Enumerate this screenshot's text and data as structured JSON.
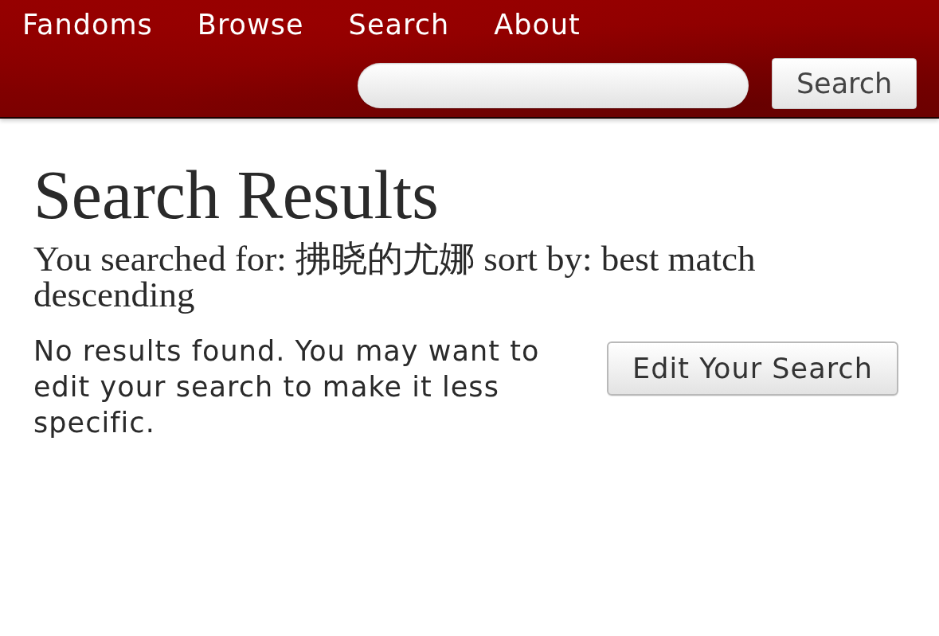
{
  "nav": {
    "links": [
      "Fandoms",
      "Browse",
      "Search",
      "About"
    ]
  },
  "search_bar": {
    "button": "Search"
  },
  "content": {
    "title": "Search Results",
    "query_summary": "You searched for: 拂晓的尤娜 sort by: best match descending",
    "message": "No results found. You may want to edit your search to make it less specific.",
    "edit_button": "Edit Your Search"
  }
}
